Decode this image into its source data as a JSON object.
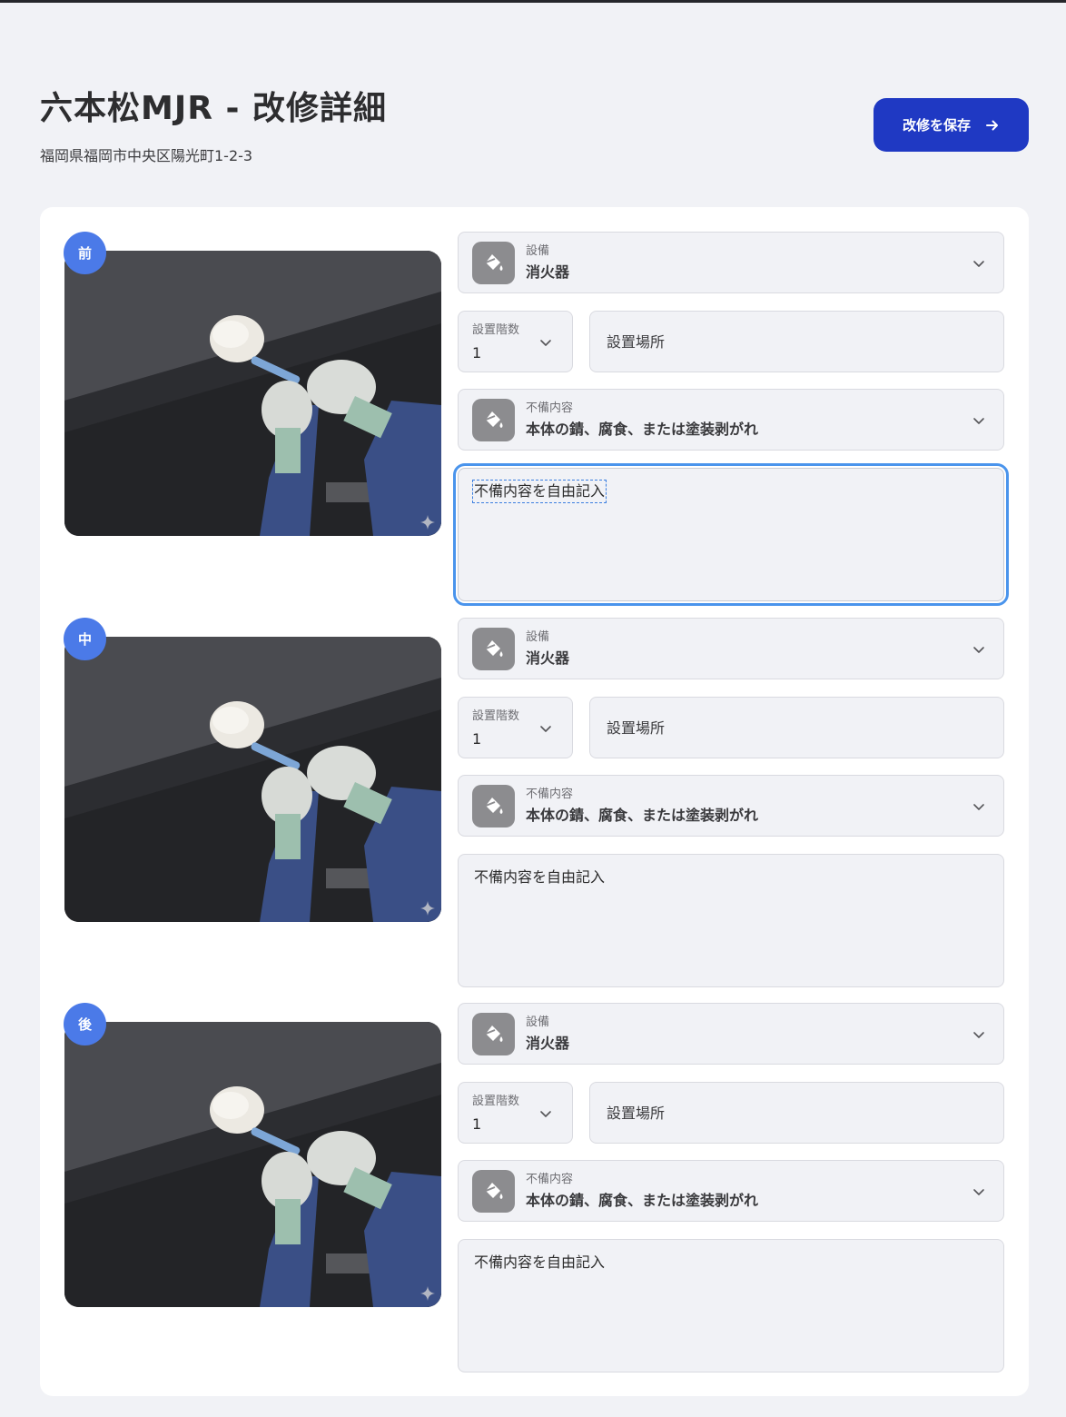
{
  "header": {
    "title": "六本松MJR - 改修詳細",
    "address": "福岡県福岡市中央区陽光町1-2-3"
  },
  "save_button": {
    "label": "改修を保存",
    "icon": "arrow-right-icon"
  },
  "sections": [
    {
      "badge": "前",
      "equipment": {
        "label": "設備",
        "value": "消火器"
      },
      "floor": {
        "label": "設置階数",
        "value": "1"
      },
      "location": {
        "placeholder": "設置場所"
      },
      "defect": {
        "label": "不備内容",
        "value": "本体の錆、腐食、または塗装剥がれ"
      },
      "notes": {
        "text": "不備内容を自由記入",
        "focused": true
      }
    },
    {
      "badge": "中",
      "equipment": {
        "label": "設備",
        "value": "消火器"
      },
      "floor": {
        "label": "設置階数",
        "value": "1"
      },
      "location": {
        "placeholder": "設置場所"
      },
      "defect": {
        "label": "不備内容",
        "value": "本体の錆、腐食、または塗装剥がれ"
      },
      "notes": {
        "text": "不備内容を自由記入",
        "focused": false
      }
    },
    {
      "badge": "後",
      "equipment": {
        "label": "設備",
        "value": "消火器"
      },
      "floor": {
        "label": "設置階数",
        "value": "1"
      },
      "location": {
        "placeholder": "設置場所"
      },
      "defect": {
        "label": "不備内容",
        "value": "本体の錆、腐食、または塗装剥がれ"
      },
      "notes": {
        "text": "不備内容を自由記入",
        "focused": false
      }
    }
  ],
  "colors": {
    "background": "#f1f2f6",
    "card": "#ffffff",
    "accent": "#1f39c3",
    "badge": "#4b7ae8",
    "focus": "#4a94ec"
  }
}
